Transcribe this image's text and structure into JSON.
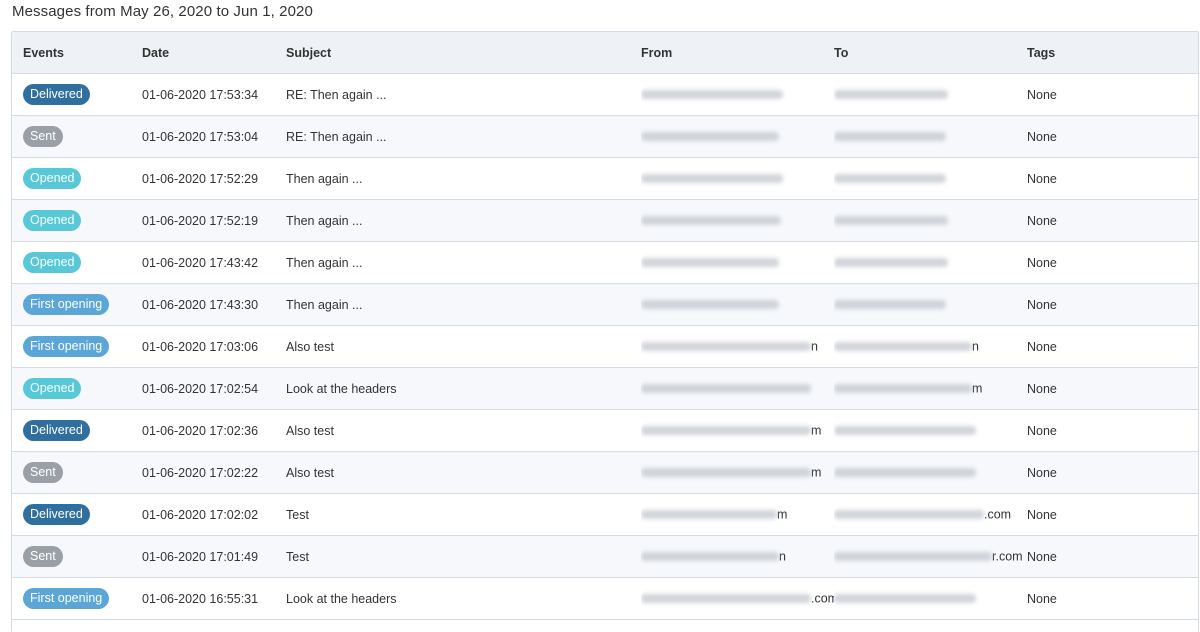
{
  "header": {
    "title": "Messages from May 26, 2020 to Jun 1, 2020"
  },
  "columns": [
    "Events",
    "Date",
    "Subject",
    "From",
    "To",
    "Tags"
  ],
  "badge_colors": {
    "Delivered": "#2f6f9f",
    "Sent": "#9aa0a6",
    "Opened": "#56c8d8",
    "First opening": "#5aa6d8"
  },
  "rows": [
    {
      "event": "Delivered",
      "date": "01-06-2020 17:53:34",
      "subject": "RE: Then again ...",
      "from_tail": "",
      "to_tail": "",
      "tags": "None"
    },
    {
      "event": "Sent",
      "date": "01-06-2020 17:53:04",
      "subject": "RE: Then again ...",
      "from_tail": "",
      "to_tail": "",
      "tags": "None"
    },
    {
      "event": "Opened",
      "date": "01-06-2020 17:52:29",
      "subject": "Then again ...",
      "from_tail": "",
      "to_tail": "",
      "tags": "None"
    },
    {
      "event": "Opened",
      "date": "01-06-2020 17:52:19",
      "subject": "Then again ...",
      "from_tail": "",
      "to_tail": "",
      "tags": "None"
    },
    {
      "event": "Opened",
      "date": "01-06-2020 17:43:42",
      "subject": "Then again ...",
      "from_tail": "",
      "to_tail": "",
      "tags": "None"
    },
    {
      "event": "First opening",
      "date": "01-06-2020 17:43:30",
      "subject": "Then again ...",
      "from_tail": "",
      "to_tail": "",
      "tags": "None"
    },
    {
      "event": "First opening",
      "date": "01-06-2020 17:03:06",
      "subject": "Also test",
      "from_tail": "n",
      "to_tail": "n",
      "tags": "None"
    },
    {
      "event": "Opened",
      "date": "01-06-2020 17:02:54",
      "subject": "Look at the headers",
      "from_tail": "",
      "to_tail": "m",
      "tags": "None"
    },
    {
      "event": "Delivered",
      "date": "01-06-2020 17:02:36",
      "subject": "Also test",
      "from_tail": "m",
      "to_tail": "",
      "tags": "None"
    },
    {
      "event": "Sent",
      "date": "01-06-2020 17:02:22",
      "subject": "Also test",
      "from_tail": "m",
      "to_tail": "",
      "tags": "None"
    },
    {
      "event": "Delivered",
      "date": "01-06-2020 17:02:02",
      "subject": "Test",
      "from_tail": "m",
      "to_tail": ".com",
      "tags": "None"
    },
    {
      "event": "Sent",
      "date": "01-06-2020 17:01:49",
      "subject": "Test",
      "from_tail": "n",
      "to_tail": "r.com",
      "tags": "None"
    },
    {
      "event": "First opening",
      "date": "01-06-2020 16:55:31",
      "subject": "Look at the headers",
      "from_tail": ".com",
      "to_tail": "",
      "tags": "None"
    }
  ]
}
